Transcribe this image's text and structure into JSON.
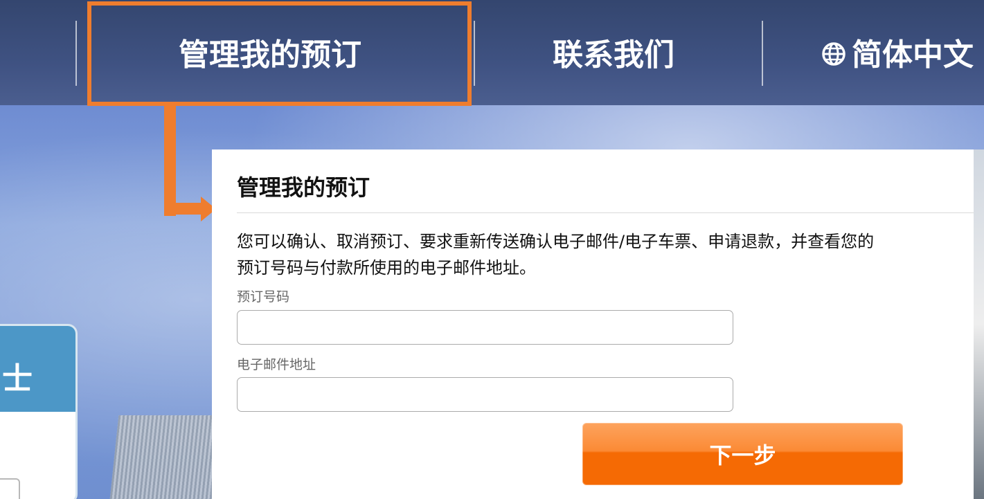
{
  "nav": {
    "items": [
      {
        "label": "管理我的预订"
      },
      {
        "label": "联系我们"
      },
      {
        "label": "简体中文",
        "icon": "globe-icon"
      }
    ]
  },
  "left_card": {
    "char": "士"
  },
  "panel": {
    "title": "管理我的预订",
    "description_line1": "您可以确认、取消预订、要求重新传送确认电子邮件/电子车票、申请退款，并查看您的",
    "description_line2": "预订号码与付款所使用的电子邮件地址。",
    "booking_number": {
      "label": "预订号码",
      "value": ""
    },
    "email": {
      "label": "电子邮件地址",
      "value": ""
    },
    "next_label": "下一步"
  },
  "colors": {
    "highlight": "#ef7d2e",
    "button": "#f56a04",
    "navbar": "#3f5282"
  }
}
